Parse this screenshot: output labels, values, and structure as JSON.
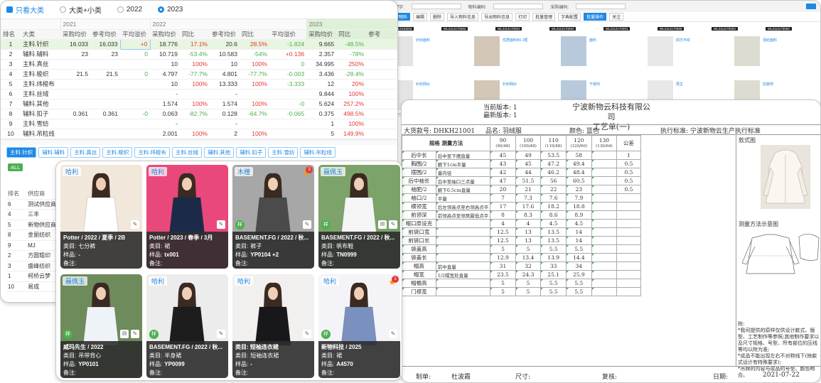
{
  "table_panel": {
    "filters": {
      "only_major": "只看大类",
      "major_minor": "大类+小类",
      "y2022": "2022",
      "y2023": "2023"
    },
    "year_headers": [
      "2021",
      "2022",
      "2023"
    ],
    "headers": [
      "排名",
      "大类",
      "采购均价",
      "参考均价",
      "平均溢价",
      "采购均价",
      "同比",
      "参考均价",
      "同比",
      "平均溢价",
      "采购均价",
      "同比",
      "参考"
    ],
    "rows": [
      {
        "rank": "1",
        "name": "主料.针织",
        "a": "16.033",
        "b": "16.033",
        "c": "+0",
        "d": "18.776",
        "e": "17.1%",
        "f": "20.6",
        "g": "28.5%",
        "h": "-1.824",
        "i": "9.665",
        "j": "-48.5%"
      },
      {
        "rank": "2",
        "name": "辅料.辅料",
        "a": "23",
        "b": "23",
        "c": "0",
        "d": "10.719",
        "e": "-53.4%",
        "f": "10.583",
        "g": "-54%",
        "h": "+0.136",
        "i": "2.357",
        "j": "-78%"
      },
      {
        "rank": "3",
        "name": "主料.真丝",
        "a": "",
        "b": "",
        "c": "",
        "d": "10",
        "e": "100%",
        "f": "10",
        "g": "100%",
        "h": "0",
        "i": "34.995",
        "j": "250%"
      },
      {
        "rank": "4",
        "name": "主料.梭织",
        "a": "21.5",
        "b": "21.5",
        "c": "0",
        "d": "4.797",
        "e": "-77.7%",
        "f": "4.801",
        "g": "-77.7%",
        "h": "-0.003",
        "i": "3.436",
        "j": "-28.4%"
      },
      {
        "rank": "5",
        "name": "主料.纬梭布",
        "a": "",
        "b": "",
        "c": "",
        "d": "10",
        "e": "100%",
        "f": "13.333",
        "g": "100%",
        "h": "-3.333",
        "i": "12",
        "j": "20%"
      },
      {
        "rank": "6",
        "name": "主料.丝绒",
        "a": "",
        "b": "",
        "c": "",
        "d": "-",
        "e": "",
        "f": "-",
        "g": "",
        "h": "",
        "i": "9.844",
        "j": "100%"
      },
      {
        "rank": "7",
        "name": "辅料.其他",
        "a": "",
        "b": "",
        "c": "",
        "d": "1.574",
        "e": "100%",
        "f": "1.574",
        "g": "100%",
        "h": "-0",
        "i": "5.624",
        "j": "257.2%"
      },
      {
        "rank": "8",
        "name": "辅料.扣子",
        "a": "0.361",
        "b": "0.361",
        "c": "-0",
        "d": "0.063",
        "e": "-82.7%",
        "f": "0.128",
        "g": "-64.7%",
        "h": "-0.065",
        "i": "0.375",
        "j": "498.5%"
      },
      {
        "rank": "9",
        "name": "主料.雪纺",
        "a": "",
        "b": "",
        "c": "",
        "d": "-",
        "e": "",
        "f": "-",
        "g": "",
        "h": "",
        "i": "1",
        "j": "100%"
      },
      {
        "rank": "10",
        "name": "辅料.吊粒线",
        "a": "",
        "b": "",
        "c": "",
        "d": "2.001",
        "e": "100%",
        "f": "2",
        "g": "100%",
        "h": "",
        "i": "5",
        "j": "149.9%"
      }
    ],
    "sub_tabs": [
      "主料.针织",
      "辅料.辅料",
      "主料.真丝",
      "主料.梭织",
      "主料.纬梭布",
      "主料.丝绒",
      "辅料.其他",
      "辅料.扣子",
      "主料.雪纺",
      "辅料.吊粒线"
    ],
    "all_label": "ALL",
    "sub_headers": [
      "排名",
      "供应商"
    ],
    "suppliers": [
      {
        "rank": "6",
        "name": "测试供应商"
      },
      {
        "rank": "4",
        "name": "三丰"
      },
      {
        "rank": "5",
        "name": "新物供应商"
      },
      {
        "rank": "8",
        "name": "金丽纺织"
      },
      {
        "rank": "9",
        "name": "MJ"
      },
      {
        "rank": "2",
        "name": "方圆辊印"
      },
      {
        "rank": "3",
        "name": "盛峰纺织"
      },
      {
        "rank": "1",
        "name": "柯桥云梦"
      },
      {
        "rank": "10",
        "name": "易成"
      }
    ]
  },
  "cards": [
    {
      "brand": "哈利",
      "title": "Potter / 2022 / 夏季 / 2B",
      "cat_label": "类目:",
      "cat": "七分裤",
      "sample_label": "样品:",
      "sample": "-",
      "note_label": "备注:",
      "img_bg": "#f1e7da",
      "img_fg": "#ffffff",
      "badge": false,
      "notif": "",
      "star": false
    },
    {
      "brand": "哈利",
      "title": "Potter / 2023 / 春季 / 3月",
      "cat_label": "类目:",
      "cat": "裙",
      "sample_label": "样品:",
      "sample": "tx001",
      "note_label": "备注:",
      "img_bg": "#e8497a",
      "img_fg": "#1c2a4a",
      "badge": false,
      "notif": "",
      "star": false
    },
    {
      "brand": "木槿",
      "title": "BASEMENT.FG / 2022 / 秋...",
      "cat_label": "类目:",
      "cat": "裤子",
      "sample_label": "样品:",
      "sample": "YP0104 +2",
      "note_label": "备注:",
      "img_bg": "#a7a7a7",
      "img_fg": "#4b4b4b",
      "badge": true,
      "notif": "3",
      "star": true
    },
    {
      "brand": "聂佩玉",
      "title": "BASEMENT.FG / 2022 / 秋...",
      "cat_label": "类目:",
      "cat": "帆布鞋",
      "sample_label": "样品:",
      "sample": "TN0999",
      "note_label": "备注:",
      "img_bg": "#7ca36a",
      "img_fg": "#f5f5f5",
      "badge": true,
      "notif": "",
      "star": false
    },
    {
      "brand": "聂佩玉",
      "title": "威玛先生 / 2022",
      "cat_label": "类目:",
      "cat": "吊带背心",
      "sample_label": "样品:",
      "sample": "YP0101",
      "note_label": "备注:",
      "img_bg": "#6e8b5c",
      "img_fg": "#eef3f7",
      "badge": true,
      "notif": "",
      "star": false
    },
    {
      "brand": "哈利",
      "title": "BASEMENT.FG / 2022 / 秋...",
      "cat_label": "类目:",
      "cat": "半身裙",
      "sample_label": "样品:",
      "sample": "YP0099",
      "note_label": "备注:",
      "img_bg": "#ececec",
      "img_fg": "#1d1d1d",
      "badge": true,
      "notif": "",
      "star": false
    },
    {
      "brand": "哈利",
      "title": "类目: 短袖连衣裙",
      "cat_label": "类目:",
      "cat": "短袖连衣裙",
      "sample_label": "样品:",
      "sample": "-",
      "note_label": "备注:",
      "img_bg": "#f2f0ee",
      "img_fg": "#18181c",
      "badge": false,
      "notif": "",
      "star": false
    },
    {
      "brand": "哈利",
      "title": "新物科技 / 2025",
      "cat_label": "类目:",
      "cat": "裙",
      "sample_label": "样品:",
      "sample": "A4570",
      "note_label": "备注:",
      "img_bg": "#f4f4f8",
      "img_fg": "#7a90bf",
      "badge": true,
      "notif": "1",
      "star": true
    }
  ],
  "catalog": {
    "search_labels": [
      "关键字:",
      "物料编码:",
      "采购编码:"
    ],
    "toolbar": [
      "新建物料",
      "编辑",
      "删除",
      "导入物料信息",
      "导出物料信息",
      "打印",
      "批量管理",
      "字典配置",
      "批量操作",
      "关注"
    ],
    "codes": [
      "WL2112310004",
      "WL2112170002",
      "WL2112170001",
      "WL2112170002",
      "WL2112170001",
      "WL2112170000",
      "WL2111170003",
      "WL2111170000"
    ],
    "item_labels": [
      "针织面料",
      "优质面料B0-1框",
      "面料",
      "四方平纹",
      "混纺面料",
      "针织网纱",
      "针织网纱",
      "干燥剂",
      "再生",
      "抗疲劳"
    ]
  },
  "spec": {
    "current_version_label": "当前版本:",
    "current_version": "1",
    "latest_version_label": "最新版本:",
    "latest_version": "1",
    "company": "宁波新物云科技有限公司",
    "doc_title": "工艺单(一)",
    "style_no": "大货款号: DHKH21001",
    "product_name": "品名: 羽绒服",
    "color": "颜色: 蓝色",
    "standard": "执行标准: 宁波新物云生产执行标准",
    "size_label": "规格",
    "method_label": "测量方法",
    "sizes": [
      {
        "top": "90",
        "bot": "(90/48)"
      },
      {
        "top": "100",
        "bot": "(100/48)"
      },
      {
        "top": "110",
        "bot": "(110/48)"
      },
      {
        "top": "120",
        "bot": "(120/60)"
      },
      {
        "top": "130",
        "bot": "(130/64)"
      }
    ],
    "tolerance_label": "公差",
    "rows": [
      {
        "part": "后中长",
        "method": "后中至下摆直量",
        "v": [
          "45",
          "49",
          "53.5",
          "58",
          ""
        ],
        "tol": "1"
      },
      {
        "part": "胸围/2",
        "method": "腋下1cm平量",
        "v": [
          "43",
          "45",
          "47.2",
          "49.4",
          ""
        ],
        "tol": "0.5"
      },
      {
        "part": "摆围/2",
        "method": "量内径",
        "v": [
          "42",
          "44",
          "46.2",
          "48.4",
          ""
        ],
        "tol": "0.5"
      },
      {
        "part": "后中袖长",
        "method": "后中至袖口三点量",
        "v": [
          "47",
          "51.5",
          "56",
          "60.5",
          ""
        ],
        "tol": "0.5"
      },
      {
        "part": "袖肥/2",
        "method": "腋下0.5cm直量",
        "v": [
          "20",
          "21",
          "22",
          "23",
          ""
        ],
        "tol": "0.5"
      },
      {
        "part": "袖口/2",
        "method": "平量",
        "v": [
          "7",
          "7.3",
          "7.6",
          "7.9",
          ""
        ],
        "tol": ""
      },
      {
        "part": "横领宽",
        "method": "后左领高点至右领高点平",
        "v": [
          "17",
          "17.6",
          "18.2",
          "18.8",
          ""
        ],
        "tol": ""
      },
      {
        "part": "前领深",
        "method": "前领高点至领窝最低点平",
        "v": [
          "8",
          "8.3",
          "8.6",
          "8.9",
          ""
        ],
        "tol": ""
      },
      {
        "part": "帽口原设克",
        "method": "",
        "v": [
          "4",
          "4",
          "4.5",
          "4.5",
          ""
        ],
        "tol": ""
      },
      {
        "part": "前袋口宽",
        "method": "",
        "v": [
          "12.5",
          "13",
          "13.5",
          "14",
          ""
        ],
        "tol": ""
      },
      {
        "part": "前袋口长",
        "method": "",
        "v": [
          "12.5",
          "13",
          "13.5",
          "14",
          ""
        ],
        "tol": ""
      },
      {
        "part": "袋盖高",
        "method": "",
        "v": [
          "5",
          "5",
          "5.5",
          "5.5",
          ""
        ],
        "tol": ""
      },
      {
        "part": "袋盖长",
        "method": "",
        "v": [
          "12.9",
          "13.4",
          "13.9",
          "14.4",
          ""
        ],
        "tol": ""
      },
      {
        "part": "帽高",
        "method": "前中直量",
        "v": [
          "31",
          "32",
          "33",
          "34",
          ""
        ],
        "tol": ""
      },
      {
        "part": "帽宽",
        "method": "1/2帽宽处直量",
        "v": [
          "23.5",
          "24.3",
          "25.1",
          "25.9",
          ""
        ],
        "tol": ""
      },
      {
        "part": "帽檐高",
        "method": "",
        "v": [
          "5",
          "5",
          "5.5",
          "5.5",
          ""
        ],
        "tol": ""
      },
      {
        "part": "门襟宽",
        "method": "",
        "v": [
          "5",
          "5",
          "5.5",
          "5.5",
          ""
        ],
        "tol": ""
      }
    ],
    "style_pic_label": "款式图",
    "measure_pic_label": "测量方法示意图",
    "notes_label": "附:",
    "notes": [
      "*我司提供的原样仅供设计款式、版型、工艺制作等参照;其他制作要求以及尺寸规格、号型、所有部位的压线等均以附为准;",
      "*成品不能出现左右不对称线下(除款式设计有特殊要求);",
      "*吊牌的内容与成品的号型、颜色吻合。"
    ],
    "maker_label": "制单:",
    "maker": "杜波霞",
    "size_label2": "尺寸:",
    "review_label": "复核:",
    "date_label": "日期:",
    "date": "2021-07-22"
  },
  "colors": {
    "accent": "#1e88e5",
    "green": "#4caf50",
    "red": "#e53935",
    "selected_row": "#e8f5e0",
    "year2023_header": "#dff0d8"
  }
}
